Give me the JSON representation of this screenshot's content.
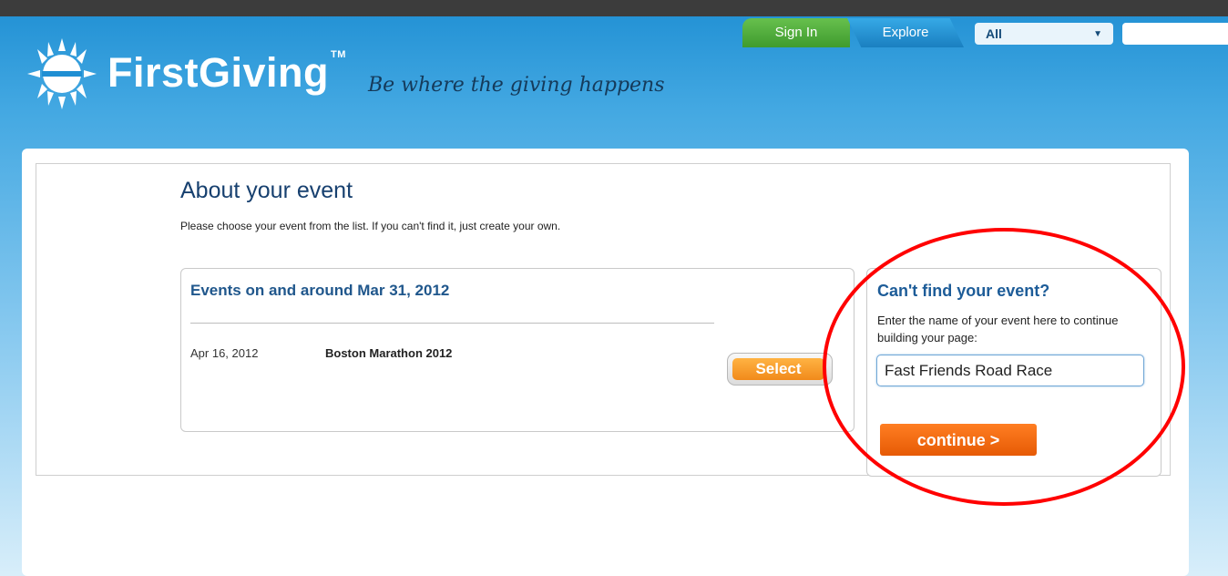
{
  "header": {
    "tab_signin": "Sign In",
    "tab_explore": "Explore",
    "filter_selected": "All",
    "search_value": ""
  },
  "logo": {
    "brand": "FirstGiving",
    "tm": "TM",
    "tagline": "Be where the giving happens"
  },
  "main": {
    "title": "About your event",
    "intro": "Please choose your event from the list. If you can't find it, just create your own.",
    "events_heading": "Events on and around Mar 31, 2012",
    "events": [
      {
        "date": "Apr 16, 2012",
        "name": "Boston Marathon 2012",
        "select_label": "Select"
      }
    ]
  },
  "side_panel": {
    "title": "Can't find your event?",
    "help": "Enter the name of your event here to continue building your page:",
    "event_name_value": "Fast Friends Road Race",
    "continue_label": "continue >"
  },
  "colors": {
    "accent_orange": "#f4831f",
    "brand_blue": "#1d5c98",
    "highlight_red": "#ff0000"
  },
  "icons": [
    "sun-logo-icon",
    "dropdown-caret-icon"
  ]
}
